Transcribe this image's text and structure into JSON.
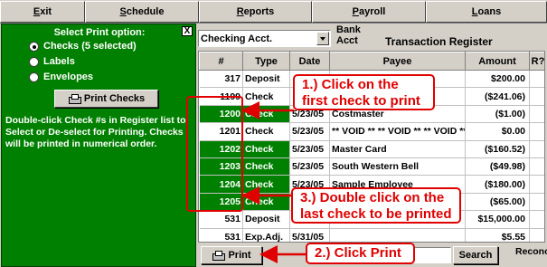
{
  "menu": {
    "items": [
      {
        "label": "Exit",
        "width": 94
      },
      {
        "label": "Schedule",
        "width": 126
      },
      {
        "label": "Reports",
        "width": 125
      },
      {
        "label": "Payroll",
        "width": 126
      },
      {
        "label": "Loans",
        "width": 134
      }
    ]
  },
  "print_panel": {
    "title": "Select Print option:",
    "close_label": "X",
    "options": [
      {
        "label": "Checks (5 selected)",
        "selected": true
      },
      {
        "label": "Labels",
        "selected": false
      },
      {
        "label": "Envelopes",
        "selected": false
      }
    ],
    "print_checks_label": "Print Checks",
    "help_text": "Double-click Check #s in Register list to Select or De-select for Printing. Checks will be printed in numerical order."
  },
  "register": {
    "account": "Checking Acct.",
    "bank_acct_label_1": "Bank",
    "bank_acct_label_2": "Acct",
    "title": "Transaction Register",
    "columns": [
      "#",
      "Type",
      "Date",
      "Payee",
      "Amount",
      "R?"
    ],
    "rows": [
      {
        "num": "317",
        "type": "Deposit",
        "date": "",
        "payee": "",
        "amount": "$200.00",
        "r": "",
        "selected": false
      },
      {
        "num": "1199",
        "type": "Check",
        "date": "",
        "payee": "",
        "amount": "($241.06)",
        "r": "",
        "selected": false
      },
      {
        "num": "1200",
        "type": "Check",
        "date": "5/23/05",
        "payee": "Costmaster",
        "amount": "($1.00)",
        "r": "",
        "selected": true
      },
      {
        "num": "1201",
        "type": "Check",
        "date": "5/23/05",
        "payee": "** VOID ** ** VOID ** ** VOID **",
        "amount": "$0.00",
        "r": "",
        "selected": false
      },
      {
        "num": "1202",
        "type": "Check",
        "date": "5/23/05",
        "payee": "Master Card",
        "amount": "($160.52)",
        "r": "",
        "selected": true
      },
      {
        "num": "1203",
        "type": "Check",
        "date": "5/23/05",
        "payee": "South Western Bell",
        "amount": "($49.98)",
        "r": "",
        "selected": true
      },
      {
        "num": "1204",
        "type": "Check",
        "date": "5/23/05",
        "payee": "Sample Employee",
        "amount": "($180.00)",
        "r": "",
        "selected": true
      },
      {
        "num": "1205",
        "type": "Check",
        "date": "",
        "payee": "",
        "amount": "($65.00)",
        "r": "",
        "selected": true
      },
      {
        "num": "531",
        "type": "Deposit",
        "date": "",
        "payee": "",
        "amount": "$15,000.00",
        "r": "",
        "selected": false
      },
      {
        "num": "531",
        "type": "Exp.Adj.",
        "date": "5/31/05",
        "payee": "",
        "amount": "$5.55",
        "r": "",
        "selected": false
      }
    ]
  },
  "bottom_bar": {
    "print_label": "Print",
    "search_label": "Search",
    "reconcile_label": "Reconc"
  },
  "annotations": {
    "step1": "1.)  Click on the first check to print",
    "step2": "2.) Click Print",
    "step3": "3.)  Double click on the last check to be printed",
    "color": "#e00000"
  },
  "colors": {
    "panel_green": "#008000",
    "selected_green": "#008000",
    "chrome": "#d4d0c8"
  }
}
